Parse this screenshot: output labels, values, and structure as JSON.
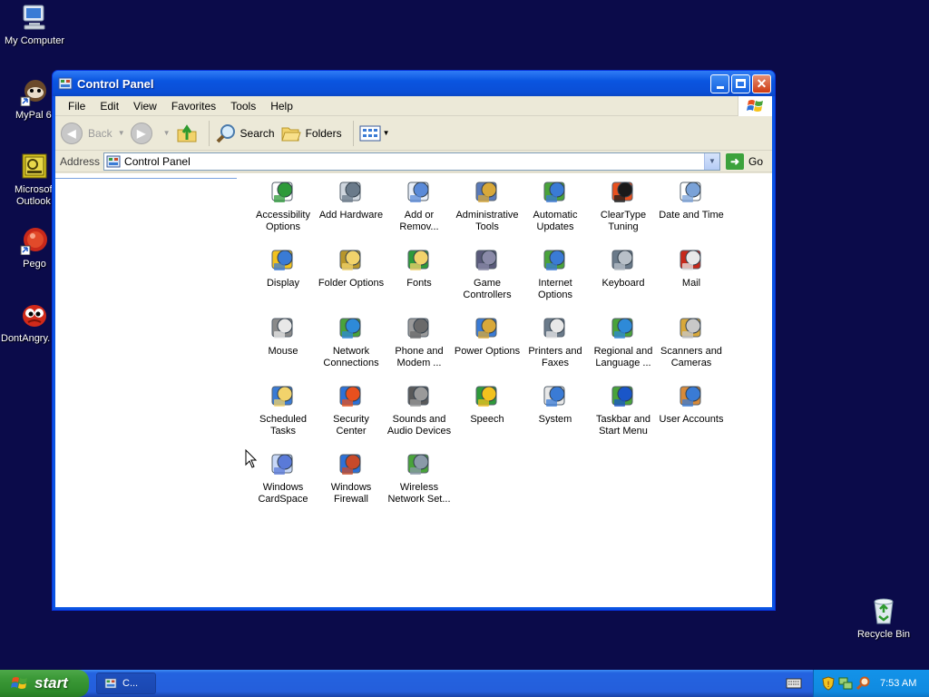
{
  "desktop": {
    "icons": [
      {
        "label": "My Computer",
        "icon": "my-computer-icon"
      },
      {
        "label": "MyPal 6",
        "icon": "mypal-icon"
      },
      {
        "label": "Microsoft Outlook",
        "line1": "Microsof",
        "line2": "Outlook",
        "icon": "outlook-icon"
      },
      {
        "label": "Pego",
        "icon": "pego-icon"
      },
      {
        "label": "DontAngry",
        "display": "DontAngry.",
        "icon": "dontangry-icon"
      },
      {
        "label": "Recycle Bin",
        "icon": "recycle-bin-icon"
      }
    ]
  },
  "window": {
    "title": "Control Panel",
    "menu": [
      "File",
      "Edit",
      "View",
      "Favorites",
      "Tools",
      "Help"
    ],
    "toolbar": {
      "back_label": "Back",
      "search_label": "Search",
      "folders_label": "Folders"
    },
    "address": {
      "label": "Address",
      "value": "Control Panel",
      "go_label": "Go"
    },
    "items": [
      {
        "l1": "Accessibility",
        "l2": "Options",
        "icon": "accessibility-icon"
      },
      {
        "l1": "Add Hardware",
        "l2": "",
        "icon": "add-hardware-icon"
      },
      {
        "l1": "Add or",
        "l2": "Remov...",
        "icon": "add-remove-programs-icon"
      },
      {
        "l1": "Administrative",
        "l2": "Tools",
        "icon": "administrative-tools-icon"
      },
      {
        "l1": "Automatic",
        "l2": "Updates",
        "icon": "automatic-updates-icon"
      },
      {
        "l1": "ClearType",
        "l2": "Tuning",
        "icon": "cleartype-icon"
      },
      {
        "l1": "Date and Time",
        "l2": "",
        "icon": "date-time-icon"
      },
      {
        "l1": "Display",
        "l2": "",
        "icon": "display-icon"
      },
      {
        "l1": "Folder Options",
        "l2": "",
        "icon": "folder-options-icon"
      },
      {
        "l1": "Fonts",
        "l2": "",
        "icon": "fonts-icon"
      },
      {
        "l1": "Game",
        "l2": "Controllers",
        "icon": "game-controllers-icon"
      },
      {
        "l1": "Internet",
        "l2": "Options",
        "icon": "internet-options-icon"
      },
      {
        "l1": "Keyboard",
        "l2": "",
        "icon": "keyboard-icon"
      },
      {
        "l1": "Mail",
        "l2": "",
        "icon": "mail-icon"
      },
      {
        "l1": "Mouse",
        "l2": "",
        "icon": "mouse-icon"
      },
      {
        "l1": "Network",
        "l2": "Connections",
        "icon": "network-connections-icon"
      },
      {
        "l1": "Phone and",
        "l2": "Modem ...",
        "icon": "phone-modem-icon"
      },
      {
        "l1": "Power Options",
        "l2": "",
        "icon": "power-options-icon"
      },
      {
        "l1": "Printers and",
        "l2": "Faxes",
        "icon": "printers-faxes-icon"
      },
      {
        "l1": "Regional and",
        "l2": "Language ...",
        "icon": "regional-language-icon"
      },
      {
        "l1": "Scanners and",
        "l2": "Cameras",
        "icon": "scanners-cameras-icon"
      },
      {
        "l1": "Scheduled",
        "l2": "Tasks",
        "icon": "scheduled-tasks-icon"
      },
      {
        "l1": "Security",
        "l2": "Center",
        "icon": "security-center-icon"
      },
      {
        "l1": "Sounds and",
        "l2": "Audio Devices",
        "icon": "sounds-audio-icon"
      },
      {
        "l1": "Speech",
        "l2": "",
        "icon": "speech-icon"
      },
      {
        "l1": "System",
        "l2": "",
        "icon": "system-icon"
      },
      {
        "l1": "Taskbar and",
        "l2": "Start Menu",
        "icon": "taskbar-start-menu-icon"
      },
      {
        "l1": "User Accounts",
        "l2": "",
        "icon": "user-accounts-icon"
      },
      {
        "l1": "Windows",
        "l2": "CardSpace",
        "icon": "cardspace-icon"
      },
      {
        "l1": "Windows",
        "l2": "Firewall",
        "icon": "windows-firewall-icon"
      },
      {
        "l1": "Wireless",
        "l2": "Network Set...",
        "icon": "wireless-network-icon"
      }
    ]
  },
  "taskbar": {
    "start_label": "start",
    "task_label": "C...",
    "clock": "7:53 AM"
  },
  "colors": {
    "desktop": "#0b0b4a",
    "titlebar": "#0a55e0",
    "start_green": "#3c9a38",
    "taskbar_blue": "#245edb"
  }
}
